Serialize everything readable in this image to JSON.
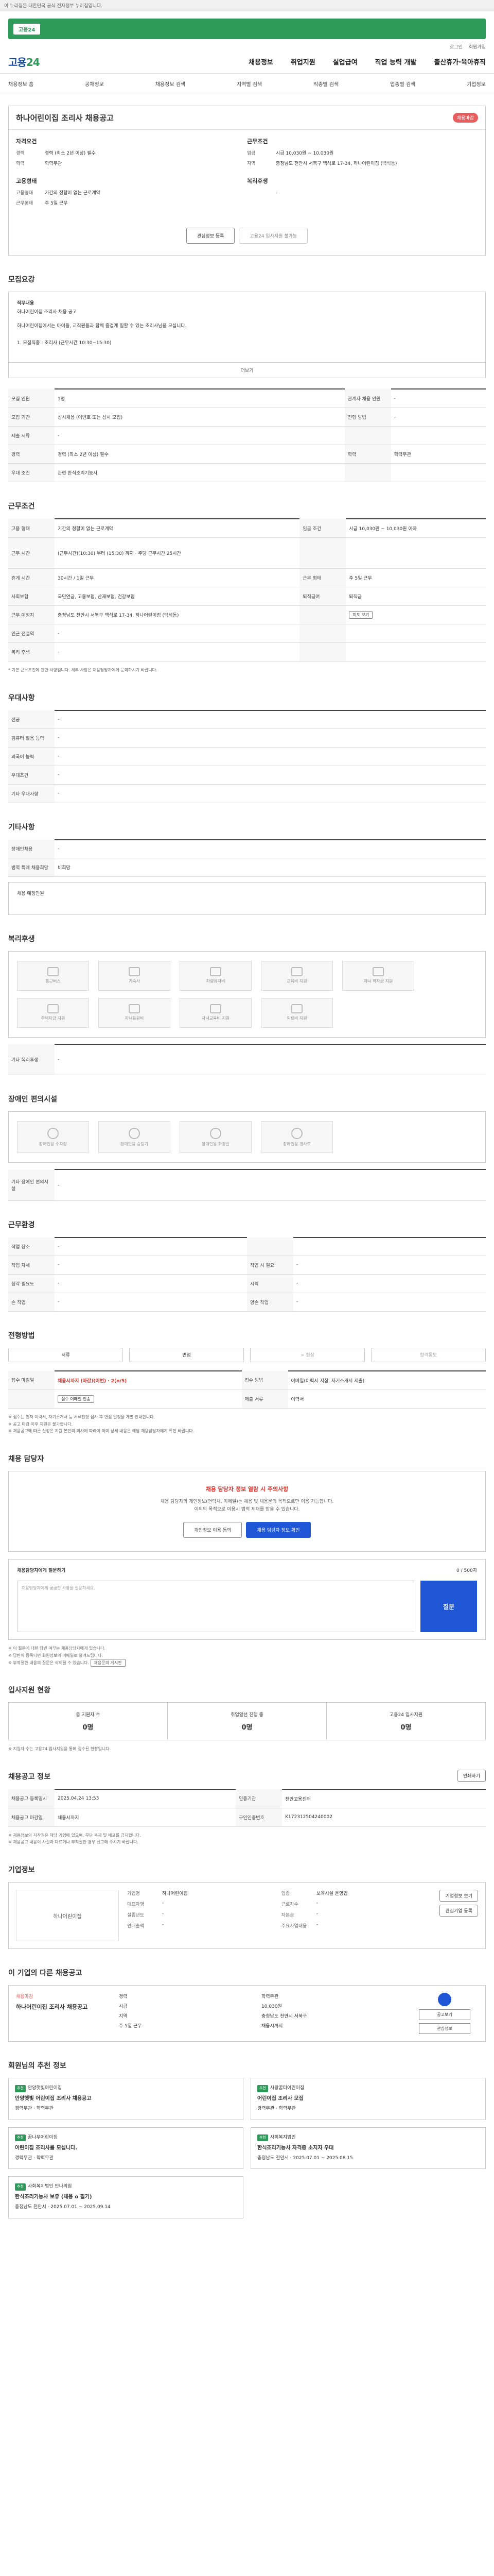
{
  "gov_banner": {
    "tag": "고용24",
    "text": "이 누리집은 대한민국 공식 전자정부 누리집입니다."
  },
  "util": {
    "login": "로그인",
    "join": "회원가입"
  },
  "header": {
    "logo_a": "고용",
    "logo_b": "24",
    "gnb": [
      "채용정보",
      "취업지원",
      "실업급여",
      "직업 능력 개발",
      "출산휴가·육아휴직"
    ]
  },
  "subnav": [
    "채용정보 홈",
    "공채정보",
    "채용정보 검색",
    "지역별 검색",
    "직종별 검색",
    "업종별 검색",
    "기업정보"
  ],
  "posting": {
    "title": "하나어린이집 조리사 채용공고",
    "badge": "채용마감",
    "left_title": "자격요건",
    "left": [
      {
        "k": "경력",
        "v": "경력 (최소 2년 이상) 필수"
      },
      {
        "k": "학력",
        "v": "학력무관"
      }
    ],
    "left_title2": "고용형태",
    "left2": [
      {
        "k": "고용형태",
        "v": "기간의 정함이 없는 근로계약"
      },
      {
        "k": "근무형태",
        "v": "주 5일 근무"
      }
    ],
    "right_title": "근무조건",
    "right": [
      {
        "k": "임금",
        "v": "시급 10,030원 ~ 10,030원"
      },
      {
        "k": "지역",
        "v": "충청남도 천안시 서북구 백석로 17-34, 하나어린이집 (백석동)"
      }
    ],
    "right_title2": "복리후생",
    "right2": [
      {
        "k": "",
        "v": "-"
      }
    ]
  },
  "buttons": {
    "scrap": "관심정보 등록",
    "apply": "고용24 입사지원 불가능"
  },
  "sec_duty": "모집요강",
  "duty": {
    "title": "직무내용",
    "l1": "하나어린이집 조리사 채용 공고",
    "l2": "하나어린이집에서는 아이들, 교직원들과 함께 즐겁게 일할 수 있는 조리사님을 모십니다.",
    "l3": "1. 모집직종 : 조리사 (근무시간 10:30~15:30)",
    "more": "더보기"
  },
  "duty_table": [
    {
      "k1": "모집 인원",
      "v1": "1명",
      "k2": "관계자 채용 인원",
      "v2": "-"
    },
    {
      "k1": "모집 기간",
      "v1": "상시채용 (이번호 또는 상시 모집)",
      "k2": "전형 방법",
      "v2": "-"
    },
    {
      "k1": "제출 서류",
      "v1": "-",
      "k2": "",
      "v2": ""
    },
    {
      "k1": "경력",
      "v1": "경력 (최소 2년 이상) 필수",
      "k2": "학력",
      "v2": "학력무관"
    },
    {
      "k1": "우대 조건",
      "v1": "관련 한식조리기능사",
      "k2": "",
      "v2": ""
    }
  ],
  "sec_cond": "근무조건",
  "cond_table": [
    {
      "k1": "고용 형태",
      "v1": "기간의 정함이 없는 근로계약",
      "k2": "임금 조건",
      "v2": "시급 10,030원 ~ 10,030원 이하"
    },
    {
      "k1": "근무 시간",
      "v1": "(근무시간)(10:30) 부터 (15:30) 까지 · 주당 근무시간 25시간",
      "k2": "",
      "v2": ""
    },
    {
      "k1": "휴게 시간",
      "v1": "30시간 / 1일 근무",
      "k2": "근무 형태",
      "v2": "주 5일 근무"
    },
    {
      "k1": "사회보험",
      "v1": "국민연금, 고용보험, 산재보험, 건강보험",
      "k2": "퇴직급여",
      "v2": "퇴직금"
    },
    {
      "k1": "근무 예정지",
      "v1": "충청남도 천안시 서북구 백석로 17-34, 하나어린이집 (백석동)",
      "k2": "",
      "v2": "지도 보기"
    },
    {
      "k1": "인근 전철역",
      "v1": "-",
      "k2": "",
      "v2": ""
    },
    {
      "k1": "복리 후생",
      "v1": "-",
      "k2": "",
      "v2": ""
    }
  ],
  "cond_note": "* 기본 근무조건에 관한 사항입니다. 세부 사항은 채용담당자에게 문의하시기 바랍니다.",
  "sec_pref": "우대사항",
  "pref_table": [
    {
      "k": "전공",
      "v": "-"
    },
    {
      "k": "컴퓨터 활용 능력",
      "v": "-"
    },
    {
      "k": "외국어 능력",
      "v": "-"
    },
    {
      "k": "우대조건",
      "v": "-"
    },
    {
      "k": "기타 우대사항",
      "v": "-"
    }
  ],
  "sec_etc": "기타사항",
  "etc_table": [
    {
      "k": "장애인채용",
      "v": "-"
    },
    {
      "k": "병역 특례 채용희망",
      "v": "비희망"
    }
  ],
  "etc_more": "채용 예정인원",
  "sec_welfare": "복리후생",
  "welfare_icons": [
    "통근버스",
    "기숙사",
    "차량유지비",
    "교육비 지원",
    "자녀 학자금 지원",
    "주택자금 지원",
    "자녀등원비",
    "자녀교육비 지원",
    "의료비 지원"
  ],
  "welfare_other_k": "기타 복리후생",
  "welfare_other_v": "-",
  "sec_disab": "장애인 편의시설",
  "disab_icons": [
    "장애인용 주차장",
    "장애인용 승강기",
    "장애인용 화장실",
    "장애인용 경사로"
  ],
  "disab_other_k": "기타 장애인 편의시설",
  "disab_other_v": "-",
  "sec_work": "근무환경",
  "work_table": [
    {
      "k1": "작업 장소",
      "v1": "-",
      "k2": "",
      "v2": ""
    },
    {
      "k1": "작업 자세",
      "v1": "-",
      "k2": "작업 시 필요",
      "v2": "-"
    },
    {
      "k1": "청각 필요도",
      "v1": "-",
      "k2": "시력",
      "v2": "-"
    },
    {
      "k1": "손 작업",
      "v1": "-",
      "k2": "양손 작업",
      "v2": "-"
    }
  ],
  "sec_proc": "전형방법",
  "proc_tabs": [
    "서류",
    "면접",
    "> 협상",
    "합격통보"
  ],
  "proc_table": [
    {
      "k1": "접수 마감일",
      "v1": "채용시까지 (마감)(이번) · 2(n/5)",
      "k2": "접수 방법",
      "v2": "이메일(이력서 지참, 자기소개서 제출)"
    },
    {
      "k1": "",
      "v1": "",
      "k2": "제출 서류",
      "v2": "이력서"
    }
  ],
  "proc_btn": "접수 이메일 전송",
  "proc_notes": [
    "※ 접수는 먼저 이력서, 자기소개서 등 서류전형 심사 후 면접 일정을 개별 안내합니다.",
    "※ 공고 마감 이후 지원은 불가합니다.",
    "※ 채용공고에 따른 신청은 지원 본인의 의사에 따라야 하며 상세 내용은 해당 채용담당자에게 확인 바랍니다."
  ],
  "sec_contact": "채용 담당자",
  "contact": {
    "alert": "채용 담당자 정보 열람 시 주의사항",
    "p1": "채용 담당자의 개인정보(연락처, 이메일)는 채용 및 채용문의 목적으로만 이용 가능합니다.",
    "p2": "이외의 목적으로 이용시 법적 제재를 받을 수 있습니다.",
    "btn1": "개인정보 이용 동의",
    "btn2": "채용 담당자 정보 확인"
  },
  "qna": {
    "title": "채용담당자에게 질문하기",
    "count": "0 / 500자",
    "placeholder": "채용담당자에게 궁금한 사항을 질문하세요.",
    "btn": "질문"
  },
  "qna_notes": [
    "※ 이 질문에 대한 답변 여부는 채용담당자에게 있습니다.",
    "※ 답변이 등록되면 회원정보의 이메일로 알려드립니다.",
    "※ 부적절한 내용의 질문은 삭제될 수 있습니다."
  ],
  "qna_link": "채용문의 게시판",
  "sec_stats": "입사지원 현황",
  "stats": [
    {
      "label": "총 지원자 수",
      "value": "0명"
    },
    {
      "label": "취업알선 진행 중",
      "value": "0명"
    },
    {
      "label": "고용24 입사지원",
      "value": "0명"
    }
  ],
  "stats_note": "※ 지원자 수는 고용24 입사지원을 통해 접수된 현황입니다.",
  "sec_manage": "채용공고 정보",
  "manage_btn": "인쇄하기",
  "manage_table": [
    {
      "k1": "채용공고 등록일시",
      "v1": "2025.04.24 13:53",
      "k2": "인증기관",
      "v2": "천안고용센터"
    },
    {
      "k1": "채용공고 마감일",
      "v1": "채용시까지",
      "k2": "구인인증번호",
      "v2": "K172312504240002"
    }
  ],
  "manage_notes": [
    "※ 채용정보의 저작권은 해당 기업에 있으며, 무단 복제 및 배포를 금지합니다.",
    "※ 채용공고 내용이 사실과 다르거나 부적절한 경우 신고해 주시기 바랍니다."
  ],
  "sec_corp": "기업정보",
  "corp": {
    "logo": "하나어린이집",
    "rows": [
      {
        "k": "기업명",
        "v": "하나어린이집"
      },
      {
        "k": "업종",
        "v": "보육시설 운영업"
      },
      {
        "k": "대표자명",
        "v": "-"
      },
      {
        "k": "근로자수",
        "v": "-"
      },
      {
        "k": "설립년도",
        "v": "-"
      },
      {
        "k": "자본금",
        "v": "-"
      },
      {
        "k": "연매출액",
        "v": "-"
      },
      {
        "k": "주요사업내용",
        "v": "-"
      }
    ],
    "btn1": "기업정보 보기",
    "btn2": "관심기업 등록"
  },
  "sec_related": "이 기업의 다른 채용공고",
  "related": {
    "tag": "채용마감",
    "name": "하나어린이집 조리사 채용공고",
    "items": [
      "경력",
      "학력무관",
      "시급",
      "10,030원",
      "지역",
      "충청남도 천안시 서북구",
      "주 5일 근무",
      "채용시까지"
    ],
    "btn1": "공고보기",
    "btn2": "관심정보"
  },
  "sec_rec": "회원님의 추천 정보",
  "recs": [
    {
      "badge": "추천",
      "org": "안양햇빛어린이집",
      "title": "안양햇빛 어린이집 조리사 채용공고",
      "info": "경력무관 · 학력무관"
    },
    {
      "badge": "추천",
      "org": "사랑꿈터어린이집",
      "title": "어린이집 조리사 모집",
      "info": "경력무관 · 학력무관"
    },
    {
      "badge": "추천",
      "org": "꿈나무어린이집",
      "title": "어린이집 조리사를 모십니다.",
      "info": "경력무관 · 학력무관"
    },
    {
      "badge": "추천",
      "org": "사회복지법인",
      "title": "한식조리기능사 자격증 소지자 우대",
      "info": "충청남도 천안시 · 2025.07.01 ~ 2025.08.15"
    },
    {
      "badge": "추천",
      "org": "사회복지법인 안나의집",
      "title": "한식조리기능사 보유 (채용 o 필기)",
      "info": "충청남도 천안시 · 2025.07.01 ~ 2025.09.14"
    }
  ]
}
